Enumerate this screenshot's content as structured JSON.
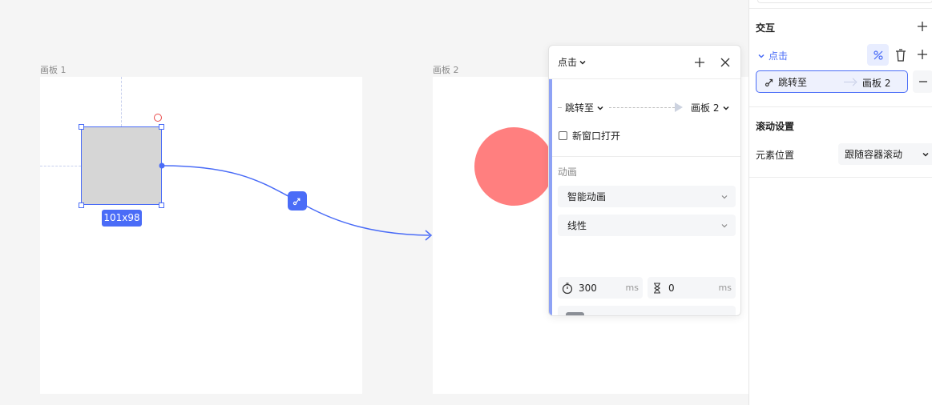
{
  "canvas": {
    "artboard1_label": "画板 1",
    "artboard2_label": "画板 2",
    "selection_size": "101x98"
  },
  "popover": {
    "trigger": "点击",
    "action": "跳转至",
    "target": "画板 2",
    "new_window_label": "新窗口打开",
    "animation_section": "动画",
    "animation_type": "智能动画",
    "easing": "线性",
    "duration": "300",
    "duration_unit": "ms",
    "delay": "0",
    "delay_unit": "ms",
    "colors": {
      "accent": "#4a6cf7",
      "swatch": "#8b8f96"
    }
  },
  "panel": {
    "interaction_title": "交互",
    "trigger": "点击",
    "action_label": "跳转至",
    "action_target": "画板 2",
    "scroll_title": "滚动设置",
    "position_label": "元素位置",
    "position_value": "跟随容器滚动"
  },
  "icons": [
    "plus-icon",
    "close-icon",
    "chevron-down-icon",
    "percent-icon",
    "trash-icon",
    "minus-icon",
    "timer-icon",
    "hourglass-icon",
    "jump-link-icon"
  ]
}
